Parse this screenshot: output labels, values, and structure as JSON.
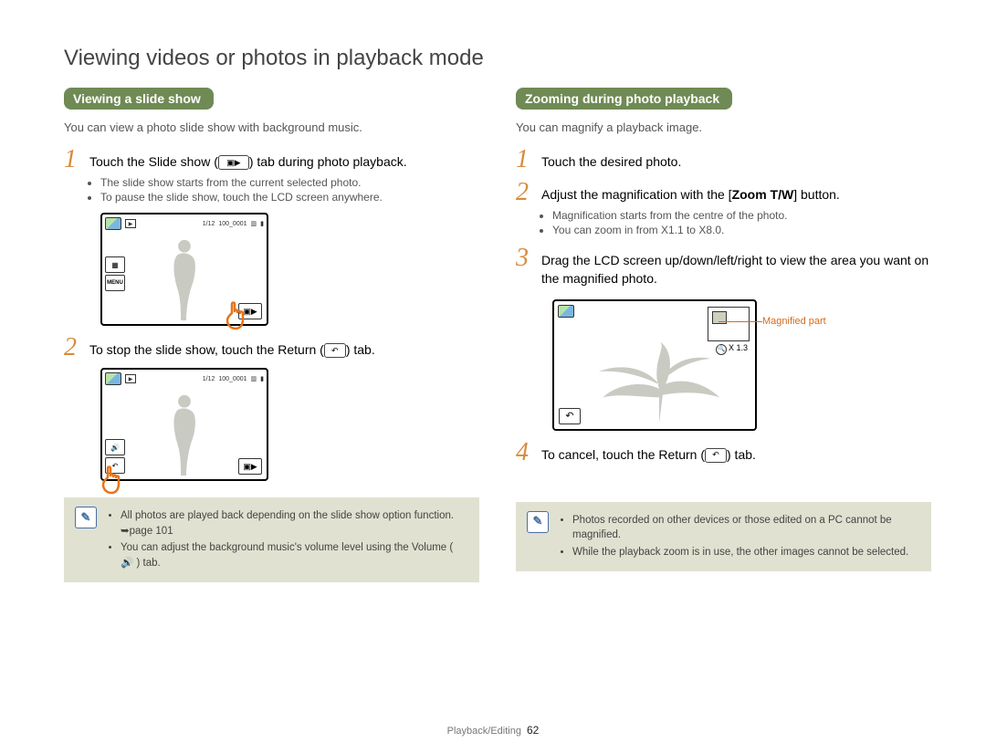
{
  "page_title": "Viewing videos or photos in playback mode",
  "footer": {
    "section": "Playback/Editing",
    "page": "62"
  },
  "left": {
    "heading": "Viewing a slide show",
    "intro": "You can view a photo slide show with background music.",
    "step1": "Touch the Slide show (",
    "step1_after": ") tab during photo playback.",
    "step1_bullets": [
      "The slide show starts from the current selected photo.",
      "To pause the slide show, touch the LCD screen anywhere."
    ],
    "step2": "To stop the slide show, touch the Return (",
    "step2_after": ") tab.",
    "lcd": {
      "count": "1/12",
      "file": "100_0001"
    },
    "menu_label": "MENU",
    "notes": [
      "All photos are played back depending on the slide show option function. ➥page 101",
      "You can adjust the background music's volume level using the Volume ( 🔊 ) tab."
    ]
  },
  "right": {
    "heading": "Zooming during photo playback",
    "intro": "You can magnify a playback image.",
    "step1": "Touch the desired photo.",
    "step2_a": "Adjust the magnification with the [",
    "step2_bold": "Zoom T/W",
    "step2_b": "] button.",
    "step2_bullets": [
      "Magnification starts from the centre of the photo.",
      "You can zoom in from X1.1 to X8.0."
    ],
    "step3": "Drag the LCD screen up/down/left/right to view the area you want on the magnified photo.",
    "callout": "Magnified part",
    "zoom_label": "X 1.3",
    "step4": "To cancel, touch the Return (",
    "step4_after": ") tab.",
    "notes": [
      "Photos recorded on other devices or those edited on a PC cannot be magnified.",
      "While the playback zoom is in use, the other images cannot be selected."
    ]
  }
}
